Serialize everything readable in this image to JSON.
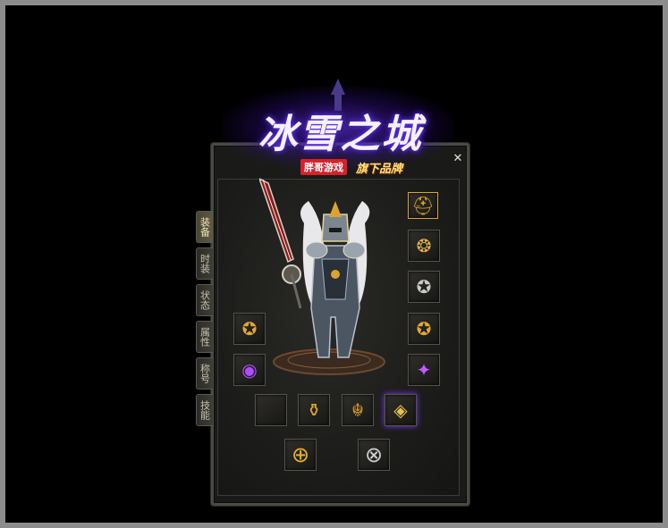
{
  "logo": {
    "title": "冰雪之城",
    "studio": "胖哥游戏",
    "brand": "旗下品牌"
  },
  "window": {
    "close_label": "✕"
  },
  "tabs": [
    {
      "label": "装备",
      "active": true
    },
    {
      "label": "时装",
      "active": false
    },
    {
      "label": "状态",
      "active": false
    },
    {
      "label": "属性",
      "active": false
    },
    {
      "label": "称号",
      "active": false
    },
    {
      "label": "技能",
      "active": false
    }
  ],
  "equipment": {
    "helmet": {
      "icon": "helmet-icon",
      "glyph": "⛑"
    },
    "necklace": {
      "icon": "necklace-icon",
      "glyph": "❂"
    },
    "bracelet_right_top": {
      "icon": "bracelet-icon",
      "glyph": "✪"
    },
    "bracelet_left": {
      "icon": "bracelet-icon",
      "glyph": "✪"
    },
    "bracelet_right": {
      "icon": "bracelet-icon",
      "glyph": "✪"
    },
    "ring_left": {
      "icon": "ring-icon",
      "glyph": "◉"
    },
    "ring_right": {
      "icon": "ring-icon",
      "glyph": "✦"
    },
    "empty_slot": {
      "icon": "empty-slot-icon",
      "glyph": ""
    },
    "belt": {
      "icon": "belt-icon",
      "glyph": "⚱"
    },
    "boots": {
      "icon": "boots-icon",
      "glyph": "☬"
    },
    "gem": {
      "icon": "gem-icon",
      "glyph": "◈"
    },
    "medal_gold": {
      "icon": "gold-medal-icon",
      "glyph": "⊕"
    },
    "medal_silver": {
      "icon": "silver-medal-icon",
      "glyph": "⊗"
    }
  },
  "colors": {
    "gold": "#d9a431",
    "purple": "#a24cff",
    "panel_border": "#4a4a44"
  }
}
